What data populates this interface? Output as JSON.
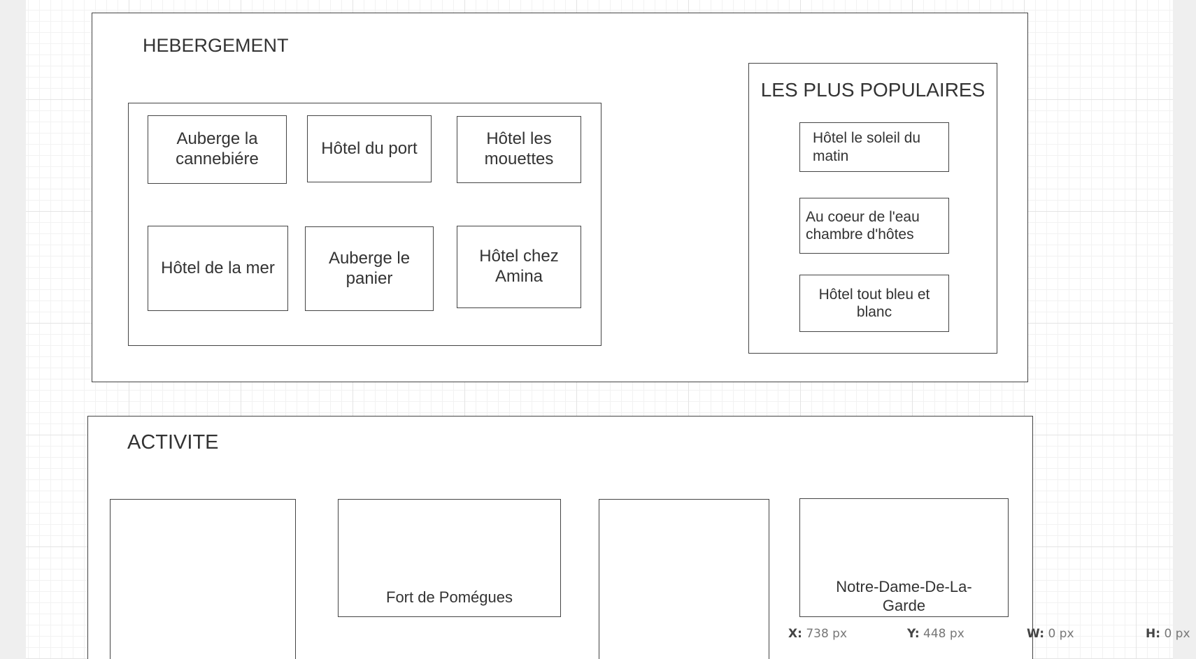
{
  "hebergement": {
    "title": "HEBERGEMENT",
    "hotels": [
      "Auberge la cannebiére",
      "Hôtel du port",
      "Hôtel les mouettes",
      "Hôtel de la mer",
      "Auberge le panier",
      "Hôtel chez Amina"
    ],
    "popular": {
      "title": "LES PLUS POPULAIRES",
      "items": [
        "Hôtel le soleil du matin",
        "Au coeur de l'eau chambre d'hôtes",
        "Hôtel tout bleu et blanc"
      ]
    }
  },
  "activite": {
    "title": "ACTIVITE",
    "cards": [
      "",
      "Fort de Pomégues",
      "",
      "Notre-Dame-De-La-Garde"
    ]
  },
  "status": {
    "x_label": "X:",
    "x_value": "738 px",
    "y_label": "Y:",
    "y_value": "448 px",
    "w_label": "W:",
    "w_value": "0 px",
    "h_label": "H:",
    "h_value": "0 px"
  }
}
